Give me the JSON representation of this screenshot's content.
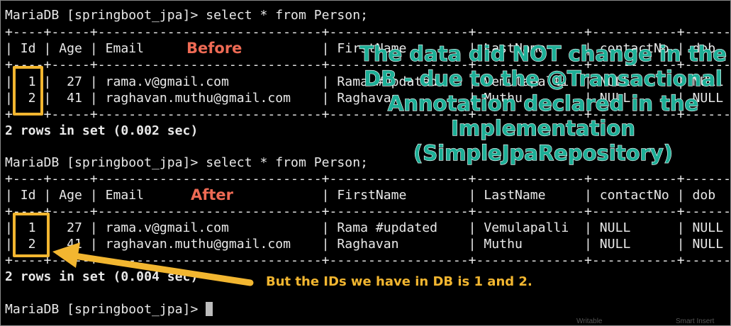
{
  "terminal": {
    "prompt1": "MariaDB [springboot_jpa]> select * from Person;",
    "border_top1": "+----+-----+-----------------------------+------------------+--------------+-----------+------+",
    "header1": "| Id | Age | Email                       | FirstName        | LastName     | contactNo | dob  |",
    "border_mid1": "+----+-----+-----------------------------+------------------+--------------+-----------+------+",
    "row1a": "|  1 |  27 | rama.v@gmail.com            | Rama #updated    | Vemulapalli  | NULL      | NULL |",
    "row1b": "|  2 |  41 | raghavan.muthu@gmail.com    | Raghavan         | Muthu        | NULL      | NULL |",
    "border_bot1": "+----+-----+-----------------------------+------------------+--------------+-----------+------+",
    "result1": "2 rows in set (0.002 sec)",
    "prompt2": "MariaDB [springboot_jpa]> select * from Person;",
    "border_top2": "+----+-----+-----------------------------+------------------+--------------+-----------+------+",
    "header2": "| Id | Age | Email                       | FirstName        | LastName     | contactNo | dob  |",
    "border_mid2": "+----+-----+-----------------------------+------------------+--------------+-----------+------+",
    "row2a": "|  1 |  27 | rama.v@gmail.com            | Rama #updated    | Vemulapalli  | NULL      | NULL |",
    "row2b": "|  2 |  41 | raghavan.muthu@gmail.com    | Raghavan         | Muthu        | NULL      | NULL |",
    "border_bot2": "+----+-----+-----------------------------+------------------+--------------+-----------+------+",
    "result2": "2 rows in set (0.004 sec)",
    "prompt3": "MariaDB [springboot_jpa]> "
  },
  "annotations": {
    "before_label": "Before",
    "after_label": "After",
    "main_note": "The data did NOT change in the DB - due to the @Transactional Annotation declared in the Implementation (SimpleJpaRepository)",
    "ids_note": "But the IDs we have in DB is 1 and 2.",
    "highlight_color": "#f2b630",
    "note_color": "#1cae96",
    "label_color": "#ee6a54"
  },
  "statusbar": {
    "left": "Writable",
    "right": "Smart Insert"
  }
}
